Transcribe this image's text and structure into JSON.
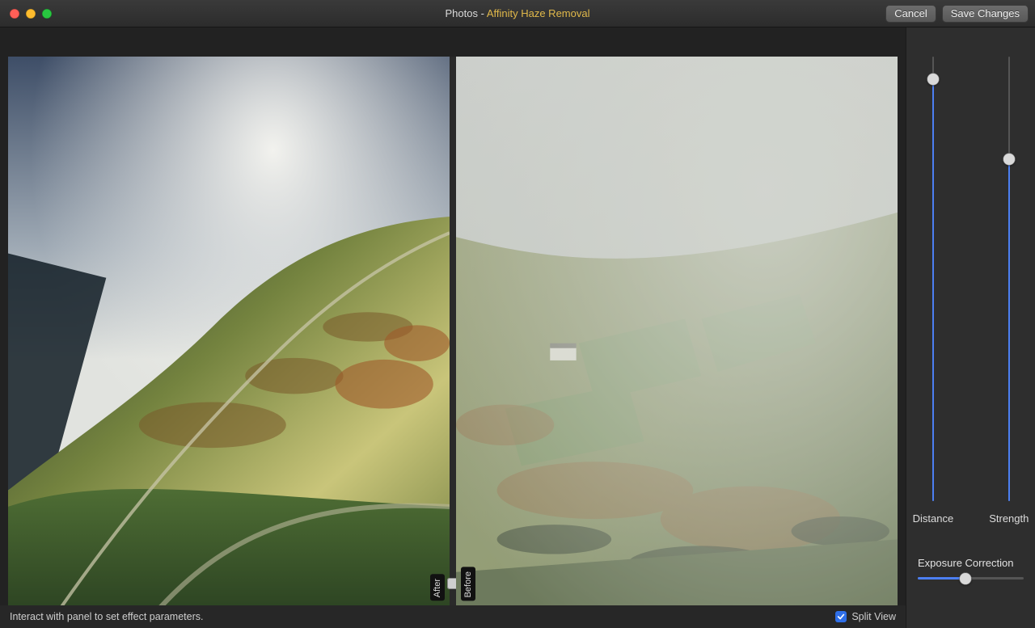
{
  "title": {
    "main": "Photos",
    "separator": " - ",
    "sub": "Affinity Haze Removal"
  },
  "buttons": {
    "cancel": "Cancel",
    "save": "Save Changes"
  },
  "labels": {
    "after": "After",
    "before": "Before",
    "footer_hint": "Interact with panel to set effect parameters.",
    "split_view": "Split View"
  },
  "sliders": {
    "distance": {
      "label": "Distance",
      "value_percent": 95
    },
    "strength": {
      "label": "Strength",
      "value_percent": 77
    },
    "exposure": {
      "label": "Exposure Correction",
      "value_percent": 45
    }
  },
  "split_view_checked": true,
  "split_position_percent": 50
}
